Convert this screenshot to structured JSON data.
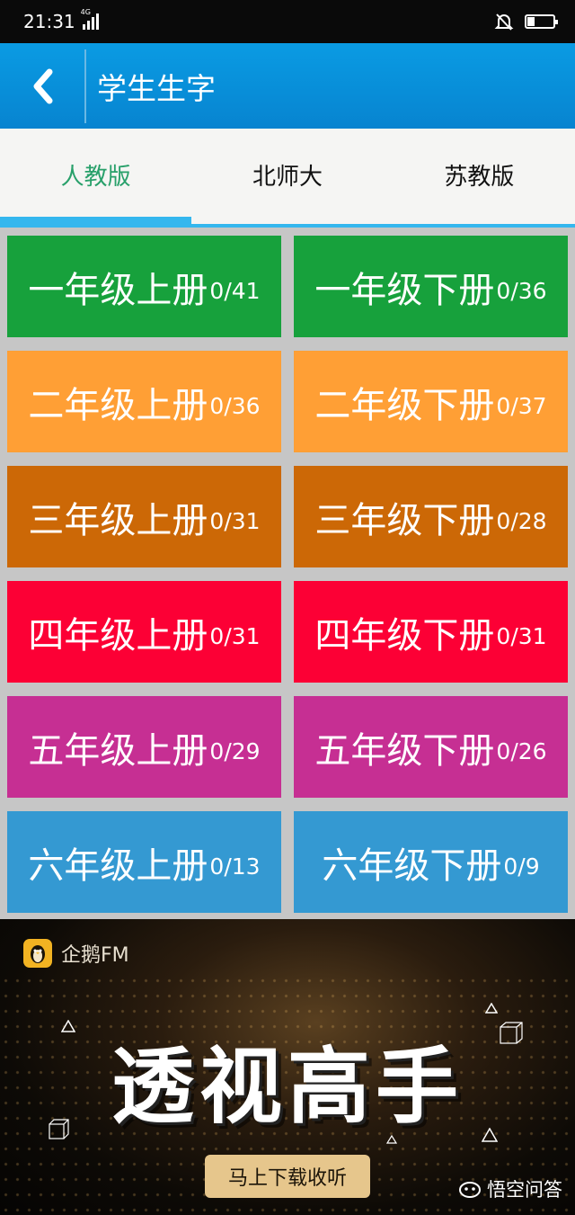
{
  "status_bar": {
    "time": "21:31",
    "network": "4G"
  },
  "header": {
    "title": "学生生字"
  },
  "tabs": [
    {
      "label": "人教版",
      "active": true
    },
    {
      "label": "北师大",
      "active": false
    },
    {
      "label": "苏教版",
      "active": false
    }
  ],
  "books": [
    {
      "title": "一年级上册",
      "count": "0/41",
      "color": "#17a13c"
    },
    {
      "title": "一年级下册",
      "count": "0/36",
      "color": "#17a13c"
    },
    {
      "title": "二年级上册",
      "count": "0/36",
      "color": "#ff9f35"
    },
    {
      "title": "二年级下册",
      "count": "0/37",
      "color": "#ff9f35"
    },
    {
      "title": "三年级上册",
      "count": "0/31",
      "color": "#cc6806"
    },
    {
      "title": "三年级下册",
      "count": "0/28",
      "color": "#cc6806"
    },
    {
      "title": "四年级上册",
      "count": "0/31",
      "color": "#fc0035"
    },
    {
      "title": "四年级下册",
      "count": "0/31",
      "color": "#fc0035"
    },
    {
      "title": "五年级上册",
      "count": "0/29",
      "color": "#c62f93"
    },
    {
      "title": "五年级下册",
      "count": "0/26",
      "color": "#c62f93"
    },
    {
      "title": "六年级上册",
      "count": "0/13",
      "color": "#3499d2"
    },
    {
      "title": "六年级下册",
      "count": "0/9",
      "color": "#3499d2"
    }
  ],
  "ad": {
    "brand": "企鹅FM",
    "headline": "透视高手",
    "cta": "马上下载收听",
    "watermark": "悟空问答"
  },
  "colors": {
    "header_bg": "#0a9be3",
    "tab_active_text": "#28a06a",
    "tab_indicator": "#34b7ee",
    "cta_bg": "#e6c68c"
  },
  "icons": [
    "back-chevron-icon",
    "mute-bell-icon",
    "battery-icon",
    "signal-icon",
    "penguin-logo-icon"
  ]
}
